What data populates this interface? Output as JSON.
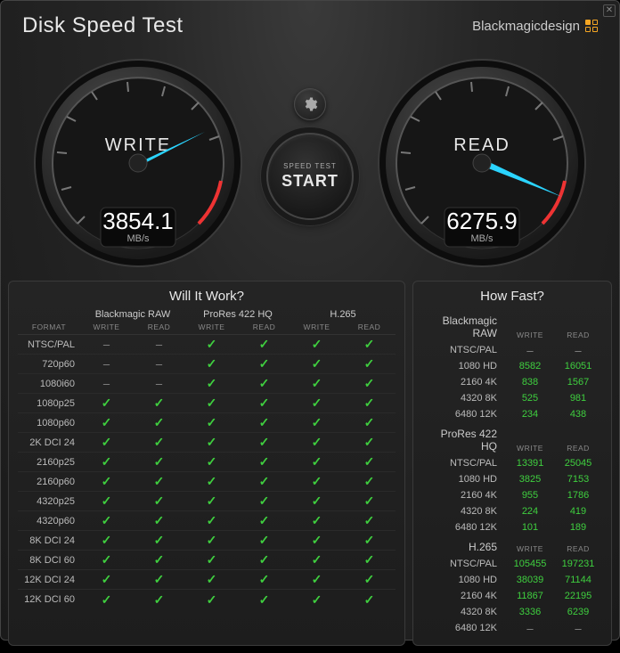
{
  "title": "Disk Speed Test",
  "brand": "Blackmagicdesign",
  "gear_icon": "gear-icon",
  "start": {
    "label": "SPEED TEST",
    "text": "START"
  },
  "gauges": {
    "write": {
      "label": "WRITE",
      "value": "3854.1",
      "unit": "MB/s",
      "angle": -158
    },
    "read": {
      "label": "READ",
      "value": "6275.9",
      "unit": "MB/s",
      "angle": -94
    }
  },
  "will_it_work": {
    "title": "Will It Work?",
    "format_header": "FORMAT",
    "rw": [
      "WRITE",
      "READ"
    ],
    "codecs": [
      "Blackmagic RAW",
      "ProRes 422 HQ",
      "H.265"
    ],
    "rows": [
      {
        "fmt": "NTSC/PAL",
        "v": [
          "-",
          "-",
          "y",
          "y",
          "y",
          "y"
        ]
      },
      {
        "fmt": "720p60",
        "v": [
          "-",
          "-",
          "y",
          "y",
          "y",
          "y"
        ]
      },
      {
        "fmt": "1080i60",
        "v": [
          "-",
          "-",
          "y",
          "y",
          "y",
          "y"
        ]
      },
      {
        "fmt": "1080p25",
        "v": [
          "y",
          "y",
          "y",
          "y",
          "y",
          "y"
        ]
      },
      {
        "fmt": "1080p60",
        "v": [
          "y",
          "y",
          "y",
          "y",
          "y",
          "y"
        ]
      },
      {
        "fmt": "2K DCI 24",
        "v": [
          "y",
          "y",
          "y",
          "y",
          "y",
          "y"
        ]
      },
      {
        "fmt": "2160p25",
        "v": [
          "y",
          "y",
          "y",
          "y",
          "y",
          "y"
        ]
      },
      {
        "fmt": "2160p60",
        "v": [
          "y",
          "y",
          "y",
          "y",
          "y",
          "y"
        ]
      },
      {
        "fmt": "4320p25",
        "v": [
          "y",
          "y",
          "y",
          "y",
          "y",
          "y"
        ]
      },
      {
        "fmt": "4320p60",
        "v": [
          "y",
          "y",
          "y",
          "y",
          "y",
          "y"
        ]
      },
      {
        "fmt": "8K DCI 24",
        "v": [
          "y",
          "y",
          "y",
          "y",
          "y",
          "y"
        ]
      },
      {
        "fmt": "8K DCI 60",
        "v": [
          "y",
          "y",
          "y",
          "y",
          "y",
          "y"
        ]
      },
      {
        "fmt": "12K DCI 24",
        "v": [
          "y",
          "y",
          "y",
          "y",
          "y",
          "y"
        ]
      },
      {
        "fmt": "12K DCI 60",
        "v": [
          "y",
          "y",
          "y",
          "y",
          "y",
          "y"
        ]
      }
    ]
  },
  "how_fast": {
    "title": "How Fast?",
    "rw": [
      "WRITE",
      "READ"
    ],
    "groups": [
      {
        "codec": "Blackmagic RAW",
        "rows": [
          {
            "res": "NTSC/PAL",
            "w": "-",
            "r": "-"
          },
          {
            "res": "1080 HD",
            "w": "8582",
            "r": "16051"
          },
          {
            "res": "2160 4K",
            "w": "838",
            "r": "1567"
          },
          {
            "res": "4320 8K",
            "w": "525",
            "r": "981"
          },
          {
            "res": "6480 12K",
            "w": "234",
            "r": "438"
          }
        ]
      },
      {
        "codec": "ProRes 422 HQ",
        "rows": [
          {
            "res": "NTSC/PAL",
            "w": "13391",
            "r": "25045"
          },
          {
            "res": "1080 HD",
            "w": "3825",
            "r": "7153"
          },
          {
            "res": "2160 4K",
            "w": "955",
            "r": "1786"
          },
          {
            "res": "4320 8K",
            "w": "224",
            "r": "419"
          },
          {
            "res": "6480 12K",
            "w": "101",
            "r": "189"
          }
        ]
      },
      {
        "codec": "H.265",
        "rows": [
          {
            "res": "NTSC/PAL",
            "w": "105455",
            "r": "197231"
          },
          {
            "res": "1080 HD",
            "w": "38039",
            "r": "71144"
          },
          {
            "res": "2160 4K",
            "w": "11867",
            "r": "22195"
          },
          {
            "res": "4320 8K",
            "w": "3336",
            "r": "6239"
          },
          {
            "res": "6480 12K",
            "w": "-",
            "r": "-"
          }
        ]
      }
    ]
  }
}
